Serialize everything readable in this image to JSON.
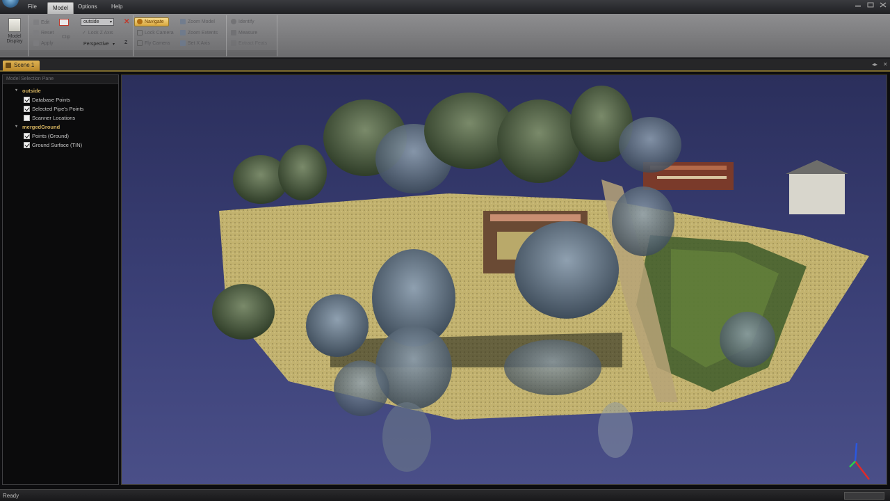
{
  "menu": {
    "file": "File",
    "model": "Model",
    "options": "Options",
    "help": "Help"
  },
  "ribbon": {
    "model_display": {
      "line1": "Model",
      "line2": "Display"
    },
    "clipping": {
      "edit": "Edit",
      "reset": "Reset",
      "apply": "Apply",
      "clip": "Clip",
      "lock_z_axis": "Lock Z Axis",
      "z_label": "Z",
      "combo_value": "outside",
      "projection_value": "Perspective"
    },
    "navigation": {
      "navigate": "Navigate",
      "lock_camera": "Lock Camera",
      "fly_camera": "Fly Camera",
      "zoom_model": "Zoom Model",
      "zoom_extents": "Zoom Extents",
      "set_x_axis": "Set X Axis"
    },
    "tools": {
      "identify": "Identify",
      "measure": "Measure",
      "extract_feats": "Extract Feats"
    }
  },
  "document": {
    "tab_label": "Scene 1"
  },
  "pane": {
    "title": "Model Selection Pane",
    "groups": [
      {
        "label": "outside",
        "items": [
          {
            "label": "Database Points",
            "checked": true
          },
          {
            "label": "Selected Pipe's Points",
            "checked": true
          },
          {
            "label": "Scanner Locations",
            "checked": false
          }
        ]
      },
      {
        "label": "mergedGround",
        "items": [
          {
            "label": "Points (Ground)",
            "checked": true
          },
          {
            "label": "Ground Surface (TIN)",
            "checked": true
          }
        ]
      }
    ]
  },
  "status": {
    "text": "Ready"
  },
  "colors": {
    "accent": "#d9a73e",
    "viewport_sky": "#3b4077",
    "ground": "#c8b66a",
    "foliage": "#4f6a3a"
  }
}
